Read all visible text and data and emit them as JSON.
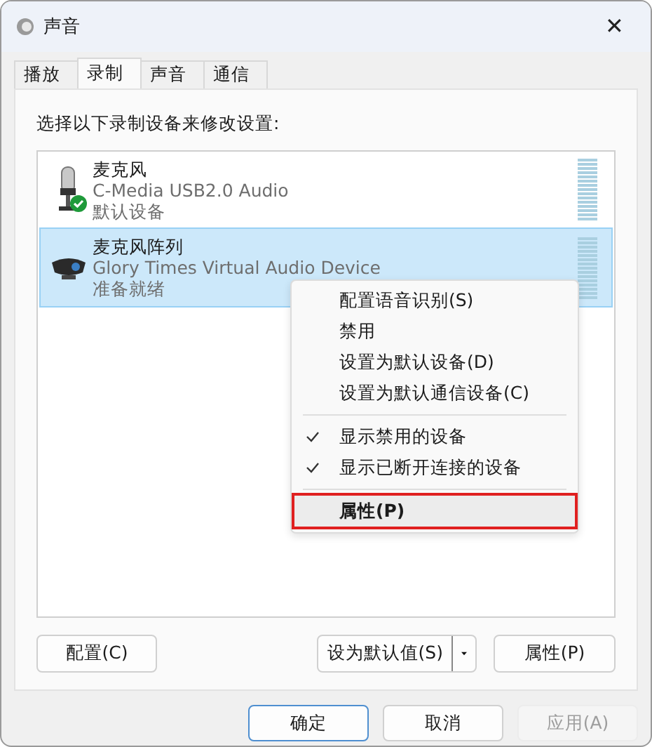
{
  "window": {
    "title": "声音",
    "close": "✕"
  },
  "tabs": [
    {
      "label": "播放",
      "selected": false
    },
    {
      "label": "录制",
      "selected": true
    },
    {
      "label": "声音",
      "selected": false
    },
    {
      "label": "通信",
      "selected": false
    }
  ],
  "instruction": "选择以下录制设备来修改设置:",
  "devices": [
    {
      "kind": "microphone",
      "name": "麦克风",
      "description": "C-Media USB2.0 Audio",
      "status": "默认设备",
      "default": true,
      "selected": false
    },
    {
      "kind": "camera",
      "name": "麦克风阵列",
      "description": "Glory Times Virtual Audio Device",
      "status": "准备就绪",
      "default": false,
      "selected": true
    }
  ],
  "context_menu": {
    "groups": [
      [
        {
          "label": "配置语音识别(S)",
          "checked": false,
          "bold": false,
          "selected": false
        },
        {
          "label": "禁用",
          "checked": false,
          "bold": false,
          "selected": false
        },
        {
          "label": "设置为默认设备(D)",
          "checked": false,
          "bold": false,
          "selected": false
        },
        {
          "label": "设置为默认通信设备(C)",
          "checked": false,
          "bold": false,
          "selected": false
        }
      ],
      [
        {
          "label": "显示禁用的设备",
          "checked": true,
          "bold": false,
          "selected": false
        },
        {
          "label": "显示已断开连接的设备",
          "checked": true,
          "bold": false,
          "selected": false
        }
      ],
      [
        {
          "label": "属性(P)",
          "checked": false,
          "bold": true,
          "selected": true
        }
      ]
    ]
  },
  "panel_buttons": {
    "configure": "配置(C)",
    "set_default": "设为默认值(S)",
    "properties": "属性(P)"
  },
  "dialog_buttons": [
    {
      "label": "确定",
      "primary": true,
      "disabled": false
    },
    {
      "label": "取消",
      "primary": false,
      "disabled": false
    },
    {
      "label": "应用(A)",
      "primary": false,
      "disabled": true
    }
  ]
}
